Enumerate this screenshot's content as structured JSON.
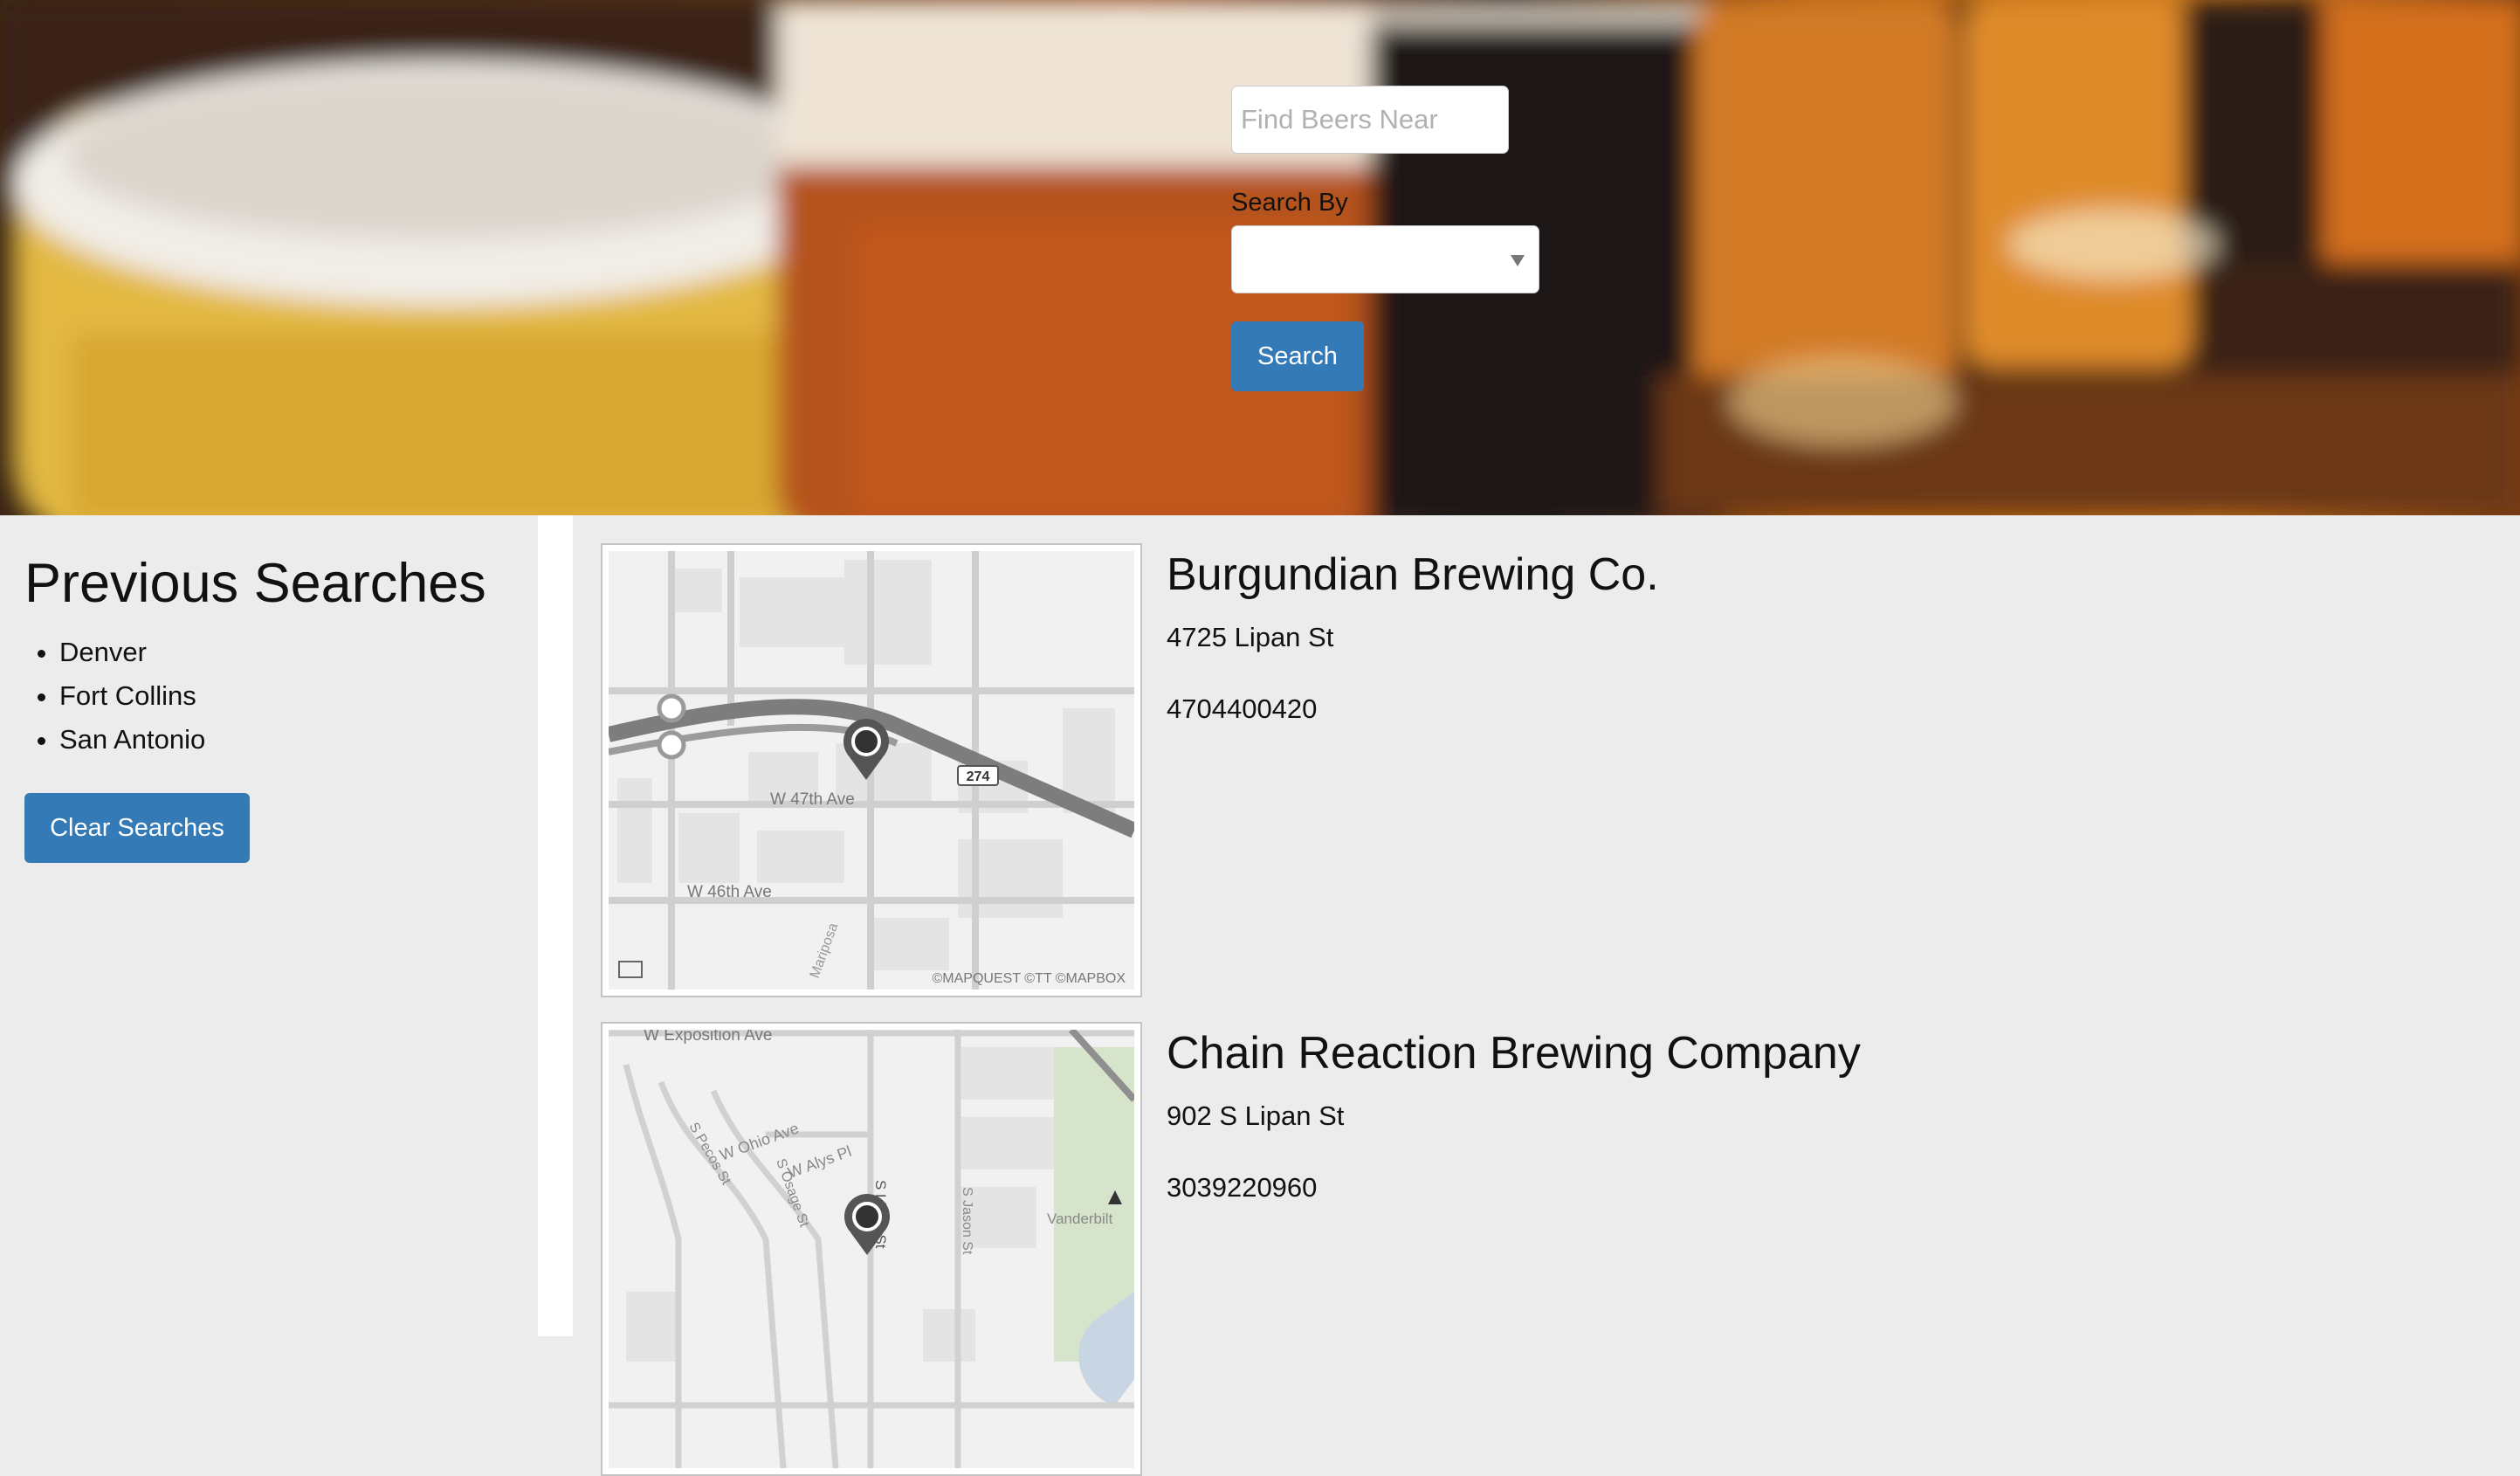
{
  "search": {
    "placeholder": "Find Beers Near",
    "search_by_label": "Search By",
    "search_by_selected": "",
    "submit_label": "Search"
  },
  "sidebar": {
    "title": "Previous Searches",
    "items": [
      "Denver",
      "Fort Collins",
      "San Antonio"
    ],
    "clear_label": "Clear Searches"
  },
  "results": [
    {
      "name": "Burgundian Brewing Co.",
      "address": "4725 Lipan St",
      "phone": "4704400420",
      "map": {
        "labels": [
          "W 47th Ave",
          "W 46th Ave",
          "Mariposa",
          "274"
        ],
        "attribution": "©MAPQUEST ©TT ©MAPBOX"
      }
    },
    {
      "name": "Chain Reaction Brewing Company",
      "address": "902 S Lipan St",
      "phone": "3039220960",
      "map": {
        "labels": [
          "W Exposition Ave",
          "W Ohio Ave",
          "S Pecos St",
          "W Alys Pl",
          "S Osage St",
          "S Jason St",
          "Vanderbilt",
          "S Lipan St"
        ]
      }
    }
  ],
  "colors": {
    "primary_button": "#337ab7",
    "page_background": "#ececec"
  },
  "icons": {
    "map_pin": "map-pin-icon",
    "map_book": "book-icon",
    "select_caret": "caret-down-icon"
  }
}
